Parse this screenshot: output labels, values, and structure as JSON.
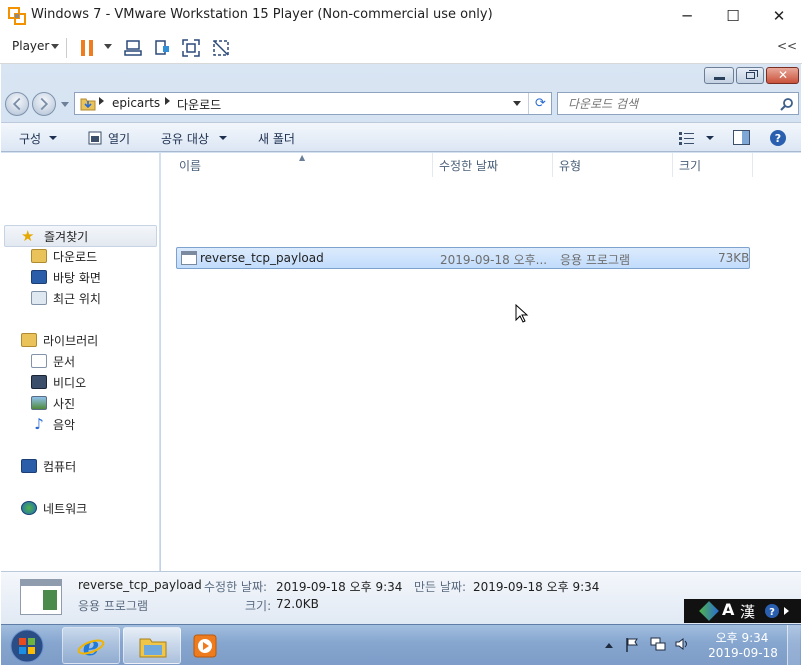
{
  "vm": {
    "title": "Windows 7 - VMware Workstation 15 Player (Non-commercial use only)",
    "menu_label": "Player",
    "collapse_label": "<<",
    "min_glyph": "─",
    "max_glyph": "☐",
    "close_glyph": "✕"
  },
  "explorer": {
    "breadcrumb": [
      "epicarts",
      "다운로드"
    ],
    "search_placeholder": "다운로드 검색",
    "commands": {
      "organize": "구성",
      "open": "열기",
      "share": "공유 대상",
      "new_folder": "새 폴더"
    },
    "favorites": {
      "header": "즐겨찾기",
      "items": [
        "다운로드",
        "바탕 화면",
        "최근 위치"
      ]
    },
    "libraries": {
      "header": "라이브러리",
      "items": [
        "문서",
        "비디오",
        "사진",
        "음악"
      ]
    },
    "computer": "컴퓨터",
    "network": "네트워크",
    "columns": [
      "이름",
      "수정한 날짜",
      "유형",
      "크기"
    ],
    "files": [
      {
        "name": "reverse_tcp_payload",
        "modified": "2019-09-18 오후...",
        "type": "응용 프로그램",
        "size": "73KB"
      }
    ],
    "details": {
      "name": "reverse_tcp_payload",
      "type": "응용 프로그램",
      "modified_label": "수정한 날짜:",
      "modified_value": "2019-09-18 오후 9:34",
      "created_label": "만든 날짜:",
      "created_value": "2019-09-18 오후 9:34",
      "size_label": "크기:",
      "size_value": "72.0KB"
    }
  },
  "taskbar": {
    "time": "오후 9:34",
    "date": "2019-09-18",
    "ime_mode": "A",
    "ime_hanja": "漢"
  },
  "colors": {
    "selection": "#c1dcfc",
    "taskbar": "#86a6cf",
    "pause_orange": "#f07c22"
  }
}
